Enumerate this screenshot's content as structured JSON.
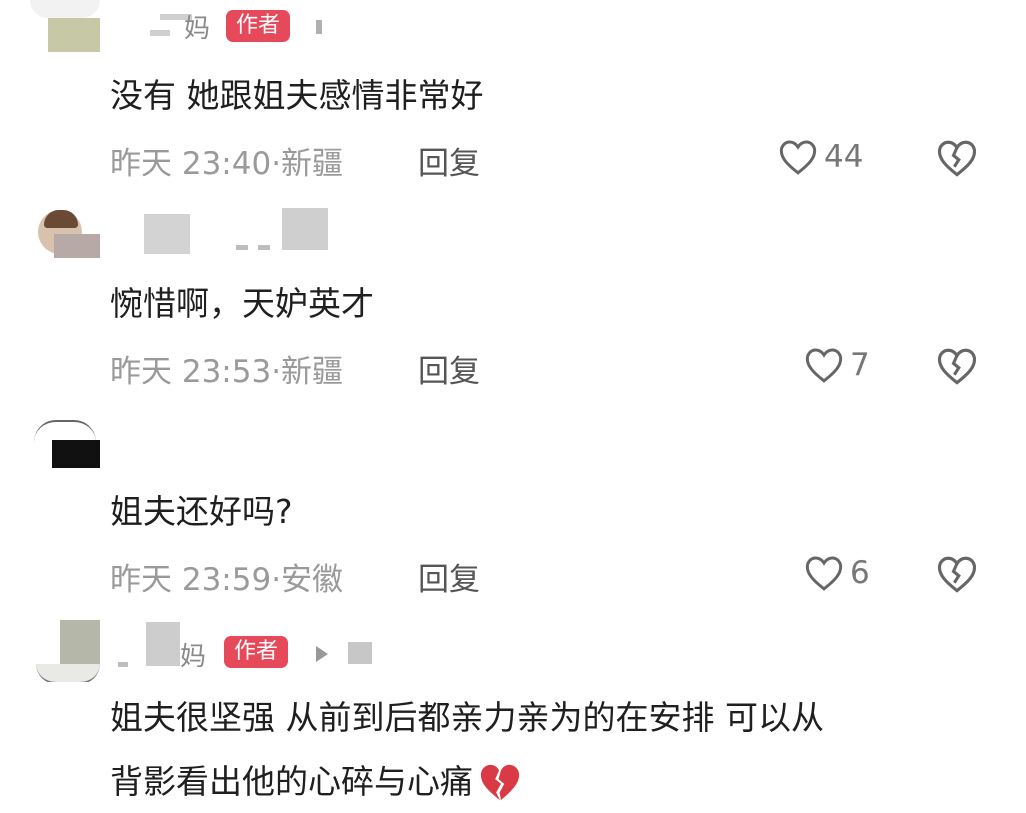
{
  "comments": [
    {
      "username": "妈",
      "badge": "作者",
      "text": "没有 她跟姐夫感情非常好",
      "meta": "昨天 23:40·新疆",
      "reply": "回复",
      "likes": "44"
    },
    {
      "username": "",
      "text": "惋惜啊，天妒英才",
      "meta": "昨天 23:53·新疆",
      "reply": "回复",
      "likes": "7"
    },
    {
      "username": "",
      "text": "姐夫还好吗?",
      "meta": "昨天 23:59·安徽",
      "reply": "回复",
      "likes": "6"
    },
    {
      "username": "妈",
      "badge": "作者",
      "text_line1": "姐夫很坚强 从前到后都亲力亲为的在安排 可以从",
      "text_line2": "背影看出他的心碎与心痛"
    }
  ],
  "icons": {
    "like": "heart-outline-icon",
    "dislike": "broken-heart-icon",
    "emoji": "broken-heart-emoji"
  },
  "colors": {
    "badge": "#e64a5a",
    "meta": "#9a9a9a",
    "emoji": "#d93a45"
  }
}
